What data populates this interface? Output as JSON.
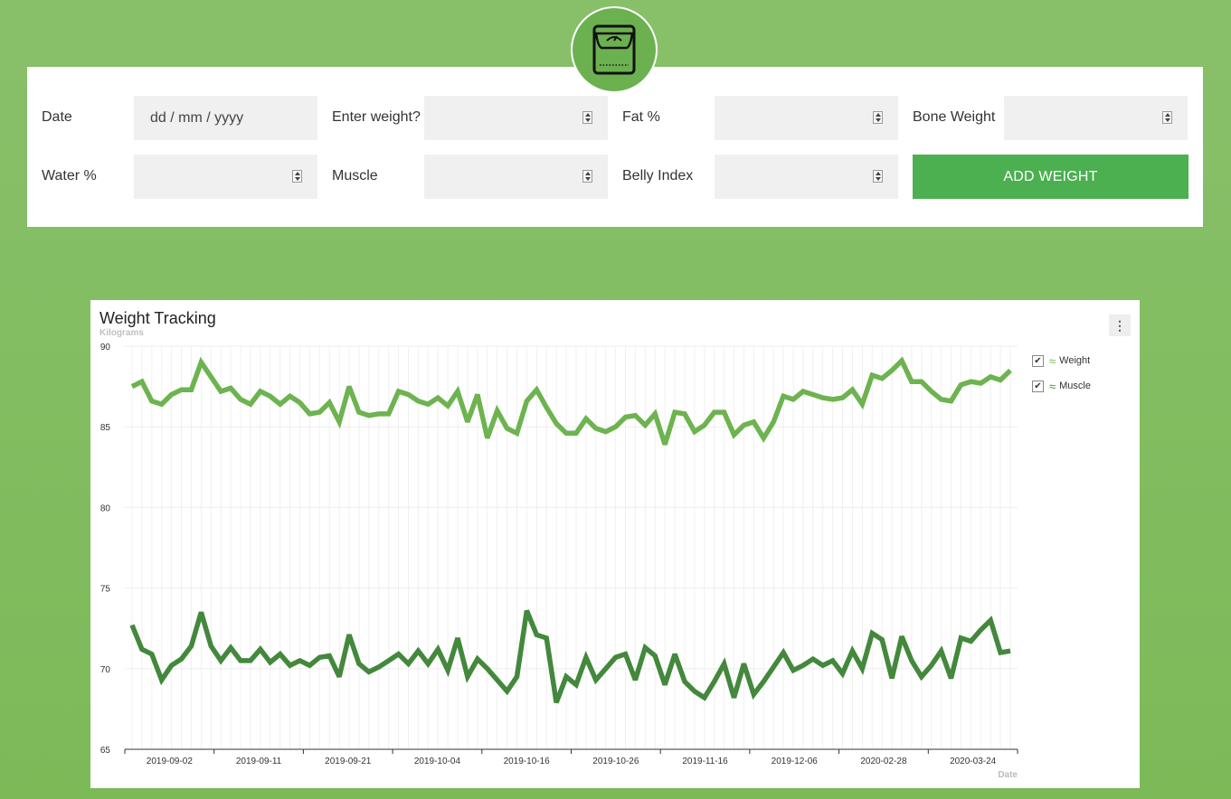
{
  "logo": {
    "icon": "scale-icon",
    "background": "#6cb14f"
  },
  "form": {
    "date_label": "Date",
    "date_placeholder": "dd / mm / yyyy",
    "weight_label": "Enter weight?",
    "fat_label": "Fat %",
    "bone_label": "Bone Weight",
    "water_label": "Water %",
    "muscle_label": "Muscle",
    "belly_label": "Belly Index",
    "add_button": "ADD WEIGHT",
    "button_color": "#4caf50"
  },
  "chart": {
    "menu_icon": "⋮",
    "legend_check": "✔",
    "legend_icon": "≈"
  },
  "chart_data": {
    "type": "line",
    "title": "Weight Tracking",
    "subtitle": "Kilograms",
    "xlabel": "Date",
    "ylim": [
      65,
      90
    ],
    "yticks": [
      65,
      70,
      75,
      80,
      85,
      90
    ],
    "xtick_labels": [
      "2019-09-02",
      "2019-09-11",
      "2019-09-21",
      "2019-10-04",
      "2019-10-16",
      "2019-10-26",
      "2019-11-16",
      "2019-12-06",
      "2020-02-28",
      "2020-03-24"
    ],
    "legend_position": "right",
    "series": [
      {
        "name": "Weight",
        "color": "#6db350",
        "values": [
          87.5,
          87.8,
          86.6,
          86.4,
          87,
          87.3,
          87.3,
          89,
          88.1,
          87.2,
          87.4,
          86.7,
          86.4,
          87.2,
          86.9,
          86.4,
          86.9,
          86.5,
          85.8,
          85.9,
          86.5,
          85.3,
          87.5,
          85.9,
          85.7,
          85.8,
          85.8,
          87.2,
          87,
          86.6,
          86.4,
          86.8,
          86.3,
          87.2,
          85.3,
          87,
          84.3,
          86,
          84.9,
          84.6,
          86.6,
          87.3,
          86.2,
          85.2,
          84.6,
          84.6,
          85.5,
          84.9,
          84.7,
          85,
          85.6,
          85.7,
          85.1,
          85.8,
          83.9,
          85.9,
          85.8,
          84.7,
          85.1,
          85.9,
          85.9,
          84.5,
          85.1,
          85.3,
          84.3,
          85.3,
          86.9,
          86.7,
          87.2,
          87,
          86.8,
          86.7,
          86.8,
          87.3,
          86.4,
          88.2,
          88,
          88.5,
          89.1,
          87.8,
          87.8,
          87.2,
          86.7,
          86.6,
          87.6,
          87.8,
          87.7,
          88.1,
          87.9,
          88.5
        ]
      },
      {
        "name": "Muscle",
        "color": "#43883c",
        "values": [
          72.7,
          71.2,
          70.9,
          69.3,
          70.2,
          70.6,
          71.4,
          73.5,
          71.4,
          70.5,
          71.3,
          70.5,
          70.5,
          71.2,
          70.4,
          70.9,
          70.2,
          70.5,
          70.2,
          70.7,
          70.8,
          69.5,
          72.1,
          70.3,
          69.8,
          70.1,
          70.5,
          70.9,
          70.3,
          71.1,
          70.3,
          71.2,
          69.9,
          71.9,
          69.5,
          70.6,
          70,
          69.3,
          68.6,
          69.5,
          73.6,
          72.1,
          71.9,
          67.9,
          69.5,
          69,
          70.7,
          69.3,
          70,
          70.7,
          70.9,
          69.3,
          71.3,
          70.8,
          69,
          70.9,
          69.2,
          68.6,
          68.2,
          69.2,
          70.3,
          68.2,
          70.3,
          68.4,
          69.2,
          70.1,
          71,
          69.9,
          70.2,
          70.6,
          70.2,
          70.5,
          69.7,
          71.1,
          70,
          72.2,
          71.8,
          69.4,
          72,
          70.5,
          69.5,
          70.2,
          71.1,
          69.4,
          71.9,
          71.7,
          72.4,
          73,
          71,
          71.1
        ]
      }
    ]
  }
}
